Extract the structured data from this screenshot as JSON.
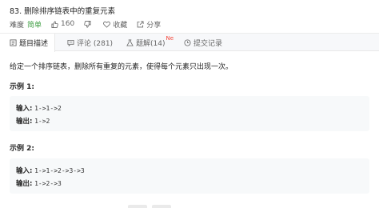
{
  "problem": {
    "title": "83. 删除排序链表中的重复元素",
    "difficulty_label": "难度",
    "difficulty": "简单",
    "likes": "160",
    "favorite_label": "收藏",
    "share_label": "分享"
  },
  "tabs": [
    {
      "label": "题目描述"
    },
    {
      "label": "评论 (281)"
    },
    {
      "label": "题解(14)",
      "badge": "Ne"
    },
    {
      "label": "提交记录"
    }
  ],
  "description": "给定一个排序链表，删除所有重复的元素，使得每个元素只出现一次。",
  "examples": [
    {
      "title": "示例 1:",
      "input_label": "输入:",
      "input": "1->1->2",
      "output_label": "输出:",
      "output": "1->2"
    },
    {
      "title": "示例 2:",
      "input_label": "输入:",
      "input": "1->1->2->3->3",
      "output_label": "输出:",
      "output": "1->2->3"
    }
  ],
  "colors": {
    "easy": "#43a047",
    "new_badge": "#f44336"
  }
}
